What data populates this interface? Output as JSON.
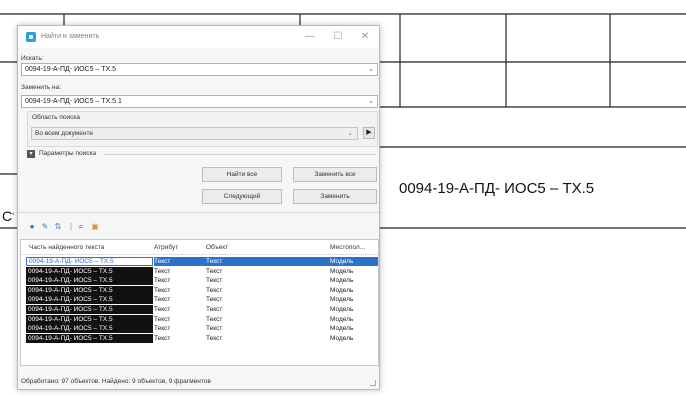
{
  "background": {
    "label": "0094-19-А-ПД- ИОС5 – ТХ.5",
    "cut_text": "Ст"
  },
  "dialog": {
    "title": "Найти и заменить",
    "window_buttons": {
      "minimize": "—",
      "maximize": "☐",
      "close": "✕"
    },
    "find": {
      "label": "Искать:",
      "value": "0094-19-А-ПД- ИОС5 – ТХ.5"
    },
    "replace": {
      "label": "Заменить на:",
      "value": "0094-19-А-ПД- ИОС5 – ТХ.5.1"
    },
    "scope": {
      "label": "Область поиска",
      "value": "Во всем документе"
    },
    "params_label": "Параметры поиска",
    "buttons": {
      "find_all": "Найти все",
      "replace_all": "Заменить все",
      "next": "Следующий",
      "replace": "Заменить"
    },
    "results": {
      "columns": [
        "Часть найденного текста",
        "Атрибут",
        "Объект",
        "Местопол..."
      ],
      "rows": [
        {
          "fragment": "0094-19-А-ПД- ИОС5 – ТХ.5",
          "attribute": "Текст",
          "object": "Текст",
          "location": "Модель"
        },
        {
          "fragment": "0094-19-А-ПД- ИОС5 – ТХ.5",
          "attribute": "Текст",
          "object": "Текст",
          "location": "Модель"
        },
        {
          "fragment": "0094-19-А-ПД- ИОС5 – ТХ.5",
          "attribute": "Текст",
          "object": "Текст",
          "location": "Модель"
        },
        {
          "fragment": "0094-19-А-ПД- ИОС5 – ТХ.5",
          "attribute": "Текст",
          "object": "Текст",
          "location": "Модель"
        },
        {
          "fragment": "0094-19-А-ПД- ИОС5 – ТХ.5",
          "attribute": "Текст",
          "object": "Текст",
          "location": "Модель"
        },
        {
          "fragment": "0094-19-А-ПД- ИОС5 – ТХ.5",
          "attribute": "Текст",
          "object": "Текст",
          "location": "Модель"
        },
        {
          "fragment": "0094-19-А-ПД- ИОС5 – ТХ.5",
          "attribute": "Текст",
          "object": "Текст",
          "location": "Модель"
        },
        {
          "fragment": "0094-19-А-ПД- ИОС5 – ТХ.5",
          "attribute": "Текст",
          "object": "Текст",
          "location": "Модель"
        },
        {
          "fragment": "0094-19-А-ПД- ИОС5 – ТХ.5",
          "attribute": "Текст",
          "object": "Текст",
          "location": "Модель"
        }
      ],
      "selected_row": 0
    },
    "status": "Обработано: 97 объектов. Найдено: 9 объектов, 9 фрагментов"
  },
  "colors": {
    "selection": "#2b73c8",
    "app_icon": "#2aa0d8"
  }
}
